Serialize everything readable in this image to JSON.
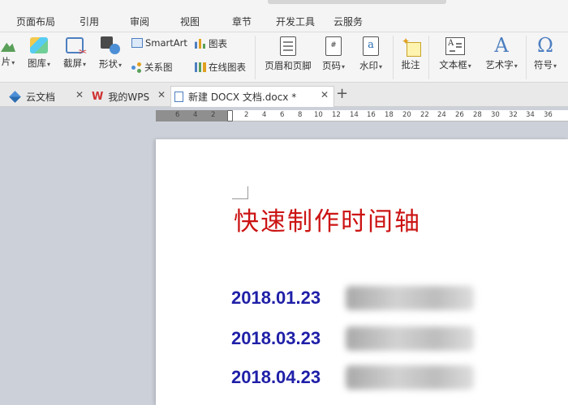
{
  "menu": {
    "tabs": [
      "页面布局",
      "引用",
      "审阅",
      "视图",
      "章节",
      "开发工具",
      "云服务"
    ]
  },
  "ribbon": {
    "picture_label": "片",
    "gallery_label": "图库",
    "screenshot_label": "截屏",
    "shape_label": "形状",
    "smartart_label": "SmartArt",
    "relation_label": "关系图",
    "chart_label": "图表",
    "online_chart_label": "在线图表",
    "header_footer_label": "页眉和页脚",
    "page_number_label": "页码",
    "watermark_label": "水印",
    "comment_label": "批注",
    "textbox_label": "文本框",
    "wordart_label": "艺术字",
    "symbol_label": "符号"
  },
  "doc_tabs": {
    "cloud_docs": "云文档",
    "my_wps": "我的WPS",
    "active_doc": "新建 DOCX 文档.docx *"
  },
  "ruler": {
    "ticks": [
      "6",
      "4",
      "2",
      "2",
      "4",
      "6",
      "8",
      "10",
      "12",
      "14",
      "16",
      "18",
      "20",
      "22",
      "24",
      "26",
      "28",
      "30",
      "32",
      "34",
      "36"
    ]
  },
  "document": {
    "title": "快速制作时间轴",
    "timeline": [
      {
        "date": "2018.01.23"
      },
      {
        "date": "2018.03.23"
      },
      {
        "date": "2018.04.23"
      }
    ]
  },
  "colors": {
    "title_red": "#cc1414",
    "date_blue": "#1f1fa8",
    "workspace_gray": "#ccd0d8"
  }
}
